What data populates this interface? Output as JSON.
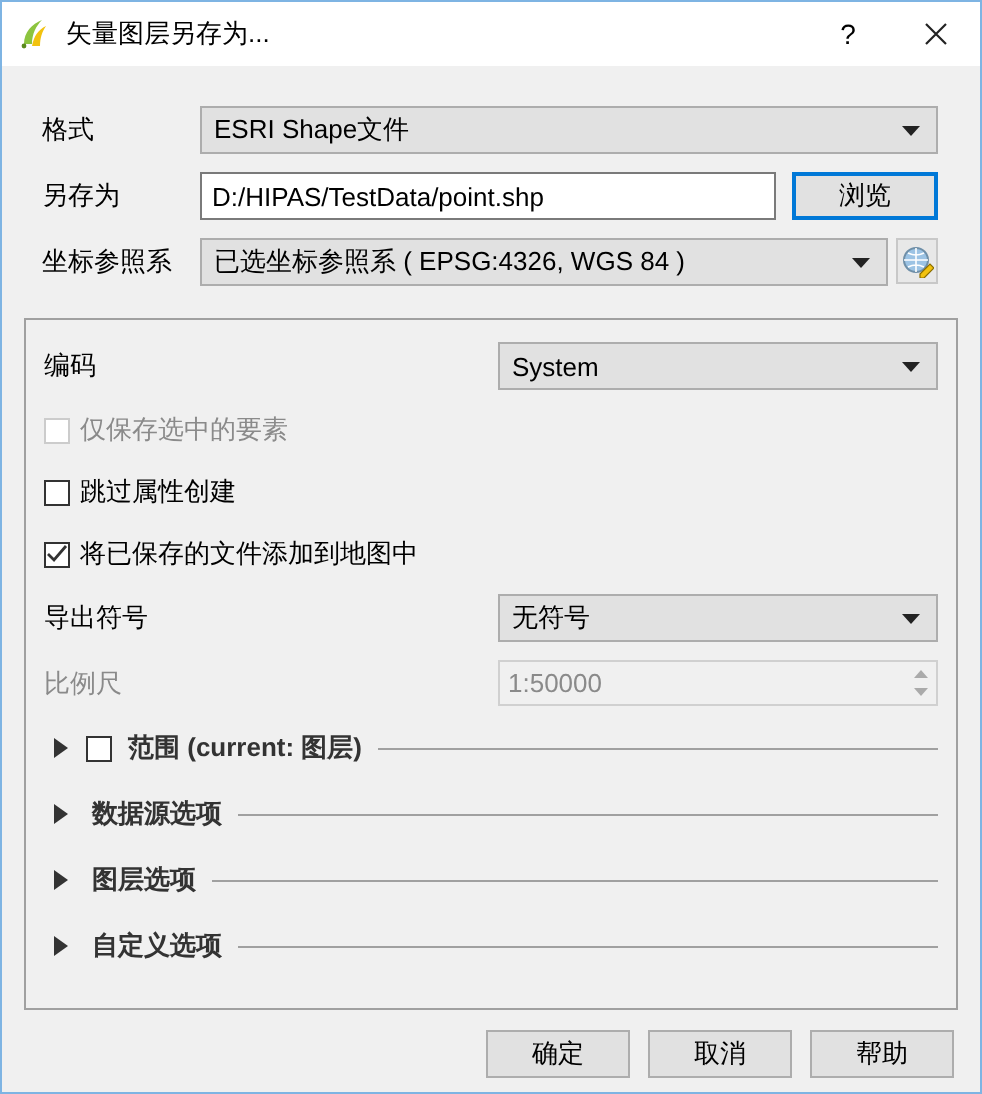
{
  "window": {
    "title": "矢量图层另存为...",
    "help": "?"
  },
  "format": {
    "label": "格式",
    "value": "ESRI Shape文件"
  },
  "save_as": {
    "label": "另存为",
    "value": "D:/HIPAS/TestData/point.shp",
    "browse": {
      "label": "浏览",
      "focused": true
    }
  },
  "crs": {
    "label": "坐标参照系",
    "value": "已选坐标参照系 ( EPSG:4326, WGS 84 )"
  },
  "options": {
    "encoding": {
      "label": "编码",
      "value": "System"
    },
    "checkboxes": [
      {
        "label": "仅保存选中的要素",
        "checked": false,
        "disabled": true
      },
      {
        "label": "跳过属性创建",
        "checked": false,
        "disabled": false
      },
      {
        "label": "将已保存的文件添加到地图中",
        "checked": true,
        "disabled": false
      }
    ],
    "symbology": {
      "label": "导出符号",
      "value": "无符号"
    },
    "scale": {
      "label": "比例尺",
      "value": "1:50000",
      "disabled": true
    }
  },
  "sections": [
    {
      "kind": "checkable",
      "title": "范围 (current: 图层)",
      "expanded": false,
      "checked": false
    },
    {
      "kind": "plain",
      "title": "数据源选项",
      "expanded": false
    },
    {
      "kind": "plain",
      "title": "图层选项",
      "expanded": false
    },
    {
      "kind": "plain",
      "title": "自定义选项",
      "expanded": false
    }
  ],
  "buttons": [
    "确定",
    "取消",
    "帮助"
  ]
}
